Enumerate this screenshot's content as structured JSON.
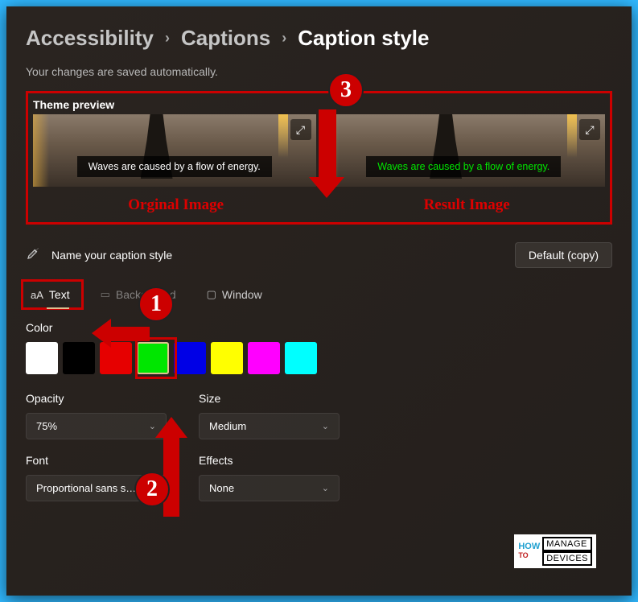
{
  "breadcrumb": {
    "item1": "Accessibility",
    "item2": "Captions",
    "item3": "Caption style"
  },
  "autosave": "Your changes are saved automatically.",
  "preview": {
    "label": "Theme preview",
    "caption_text": "Waves are caused by a flow of energy.",
    "original_tag": "Orginal Image",
    "result_tag": "Result Image"
  },
  "name_row": {
    "label": "Name your caption style",
    "button": "Default (copy)"
  },
  "tabs": {
    "text": "Text",
    "background": "Background",
    "window": "Window"
  },
  "color": {
    "label": "Color",
    "swatches": [
      "#ffffff",
      "#000000",
      "#e60000",
      "#00e600",
      "#0000e6",
      "#ffff00",
      "#ff00ff",
      "#00ffff"
    ],
    "selected_index": 3
  },
  "controls": {
    "opacity": {
      "label": "Opacity",
      "value": "75%"
    },
    "size": {
      "label": "Size",
      "value": "Medium"
    },
    "font": {
      "label": "Font",
      "value": "Proportional sans s…"
    },
    "effects": {
      "label": "Effects",
      "value": "None"
    }
  },
  "annotations": {
    "n1": "1",
    "n2": "2",
    "n3": "3"
  },
  "logo": {
    "how": "HOW",
    "to": "TO",
    "manage": "MANAGE",
    "devices": "DEVICES"
  }
}
